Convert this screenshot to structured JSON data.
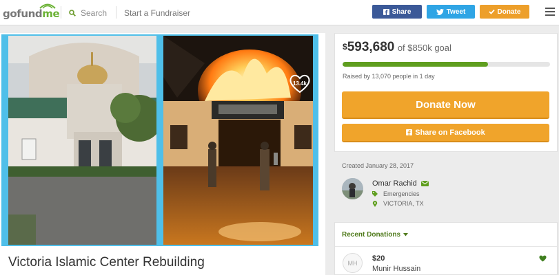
{
  "header": {
    "logo_main": "gofund",
    "logo_accent": "me",
    "search_label": "Search",
    "start_label": "Start a Fundraiser",
    "share_label": "Share",
    "tweet_label": "Tweet",
    "donate_label": "Donate"
  },
  "campaign": {
    "title": "Victoria Islamic Center Rebuilding",
    "likes": "13.4k"
  },
  "donation": {
    "currency": "$",
    "raised": "593,680",
    "goal_text": "of $850k goal",
    "progress_fraction": 0.7,
    "raised_text": "Raised by 13,070 people in 1 day",
    "donate_now": "Donate Now",
    "share_facebook": "Share on Facebook"
  },
  "organizer": {
    "created": "Created January 28, 2017",
    "name": "Omar Rachid",
    "category": "Emergencies",
    "location": "VICTORIA, TX"
  },
  "recent": {
    "title": "Recent Donations",
    "donor_initials": "MH",
    "donor_amount": "$20",
    "donor_name": "Munir Hussain"
  },
  "colors": {
    "facebook": "#3b5998",
    "twitter": "#2fa5e5",
    "donate_orange": "#f0a42b",
    "progress_green": "#5f9e1f",
    "photo_border": "#4fbfe9"
  }
}
